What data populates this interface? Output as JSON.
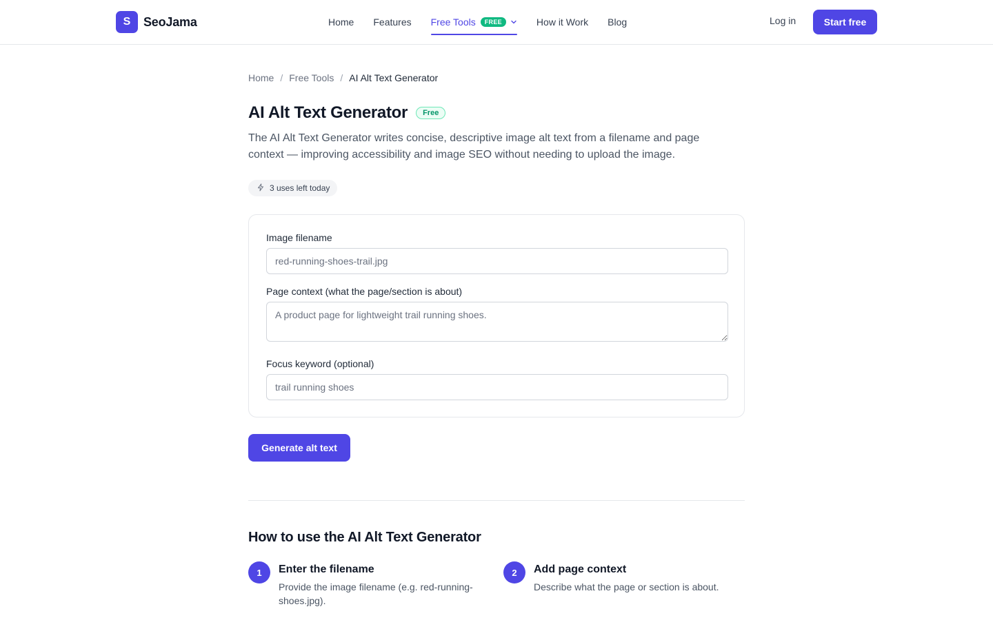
{
  "header": {
    "logo_letter": "S",
    "brand": "SeoJama",
    "nav": [
      {
        "label": "Home"
      },
      {
        "label": "Features"
      },
      {
        "label": "Free Tools",
        "badge": "FREE"
      },
      {
        "label": "How it Work"
      },
      {
        "label": "Blog"
      }
    ],
    "login": "Log in",
    "start": "Start free"
  },
  "breadcrumb": [
    "Home",
    "Free Tools",
    "AI Alt Text Generator"
  ],
  "page": {
    "title": "AI Alt Text Generator",
    "badge": "Free",
    "description": "The AI Alt Text Generator writes concise, descriptive image alt text from a filename and page context — improving accessibility and image SEO without needing to upload the image.",
    "uses_left": "3 uses left today"
  },
  "form": {
    "filename_label": "Image filename",
    "filename_placeholder": "red-running-shoes-trail.jpg",
    "context_label": "Page context (what the page/section is about)",
    "context_placeholder": "A product page for lightweight trail running shoes.",
    "keyword_label": "Focus keyword (optional)",
    "keyword_placeholder": "trail running shoes",
    "submit": "Generate alt text"
  },
  "howto": {
    "title": "How to use the AI Alt Text Generator",
    "steps": [
      {
        "num": "1",
        "title": "Enter the filename",
        "text": "Provide the image filename (e.g. red-running-shoes.jpg)."
      },
      {
        "num": "2",
        "title": "Add page context",
        "text": "Describe what the page or section is about."
      }
    ]
  },
  "colors": {
    "accent": "#4f46e5",
    "free_badge": "#10b981"
  }
}
